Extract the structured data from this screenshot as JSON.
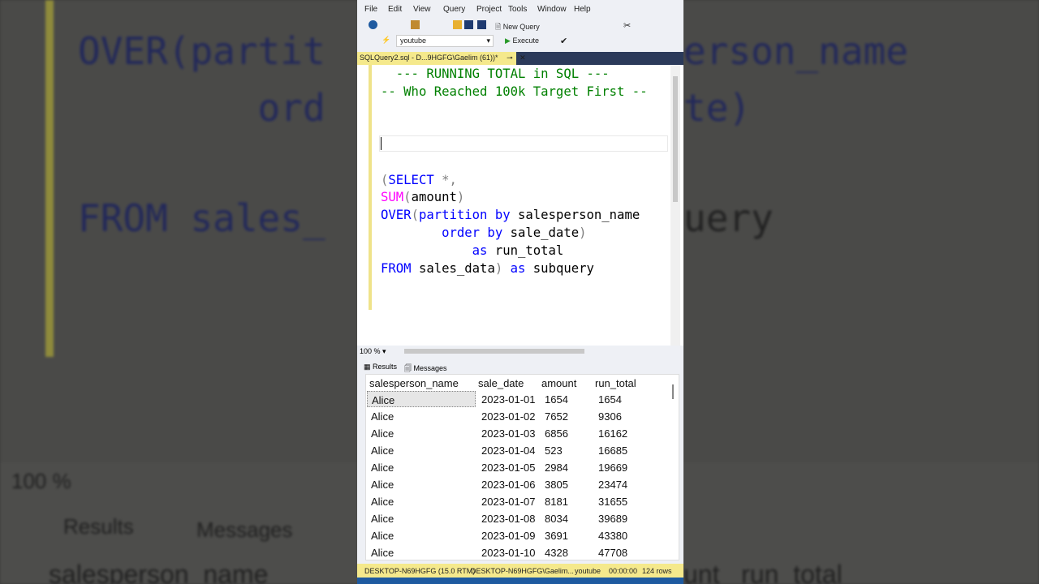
{
  "menu": [
    "File",
    "Edit",
    "View",
    "Query",
    "Project",
    "Tools",
    "Window",
    "Help"
  ],
  "toolbar": {
    "new_query": "New Query",
    "database": "youtube",
    "execute": "Execute"
  },
  "tab": {
    "title": "SQLQuery2.sql - D...9HGFG\\Gaelim (61))*",
    "pin": "⊸",
    "close": "✕"
  },
  "code": [
    [
      {
        "t": "  --- RUNNING TOTAL in SQL ---",
        "c": "#008000"
      }
    ],
    [
      {
        "t": "-- Who Reached 100k Target First --",
        "c": "#008000"
      }
    ],
    [],
    [],
    [],
    [],
    [
      {
        "t": "(",
        "c": "#808080"
      },
      {
        "t": "SELECT",
        "c": "#0000ff"
      },
      {
        "t": " *,",
        "c": "#808080"
      }
    ],
    [
      {
        "t": "SUM",
        "c": "#ff00ff"
      },
      {
        "t": "(",
        "c": "#808080"
      },
      {
        "t": "amount",
        "c": "#000"
      },
      {
        "t": ")",
        "c": "#808080"
      }
    ],
    [
      {
        "t": "OVER",
        "c": "#0000ff"
      },
      {
        "t": "(",
        "c": "#808080"
      },
      {
        "t": "partition by",
        "c": "#0000ff"
      },
      {
        "t": " salesperson_name",
        "c": "#000"
      }
    ],
    [
      {
        "t": "        order by",
        "c": "#0000ff"
      },
      {
        "t": " sale_date",
        "c": "#000"
      },
      {
        "t": ")",
        "c": "#808080"
      }
    ],
    [
      {
        "t": "            as",
        "c": "#0000ff"
      },
      {
        "t": " run_total",
        "c": "#000"
      }
    ],
    [
      {
        "t": "FROM",
        "c": "#0000ff"
      },
      {
        "t": " sales_data",
        "c": "#000"
      },
      {
        "t": ")",
        "c": "#808080"
      },
      {
        "t": " as",
        "c": "#0000ff"
      },
      {
        "t": " subquery",
        "c": "#000"
      }
    ]
  ],
  "zoom": "100 %",
  "results_tabs": {
    "results": "Results",
    "messages": "Messages"
  },
  "grid": {
    "columns": [
      "salesperson_name",
      "sale_date",
      "amount",
      "run_total"
    ],
    "rows": [
      [
        "Alice",
        "2023-01-01",
        "1654",
        "1654"
      ],
      [
        "Alice",
        "2023-01-02",
        "7652",
        "9306"
      ],
      [
        "Alice",
        "2023-01-03",
        "6856",
        "16162"
      ],
      [
        "Alice",
        "2023-01-04",
        "523",
        "16685"
      ],
      [
        "Alice",
        "2023-01-05",
        "2984",
        "19669"
      ],
      [
        "Alice",
        "2023-01-06",
        "3805",
        "23474"
      ],
      [
        "Alice",
        "2023-01-07",
        "8181",
        "31655"
      ],
      [
        "Alice",
        "2023-01-08",
        "8034",
        "39689"
      ],
      [
        "Alice",
        "2023-01-09",
        "3691",
        "43380"
      ],
      [
        "Alice",
        "2023-01-10",
        "4328",
        "47708"
      ]
    ]
  },
  "status": {
    "server": "DESKTOP-N69HGFG (15.0 RTM)",
    "user": "DESKTOP-N69HGFG\\Gaelim...",
    "db": "youtube",
    "time": "00:00:00",
    "rows": "124 rows"
  },
  "background": {
    "l1": "OVER(partit",
    "l2": "        ord",
    "l3": "FROM sales_",
    "r1": "erson_name",
    "r2": "te)",
    "r3": "uery",
    "zoom": "100 %",
    "results": "Results",
    "messages": "Messages",
    "h1": "salesperson_name",
    "h2": "unt   run_total"
  }
}
